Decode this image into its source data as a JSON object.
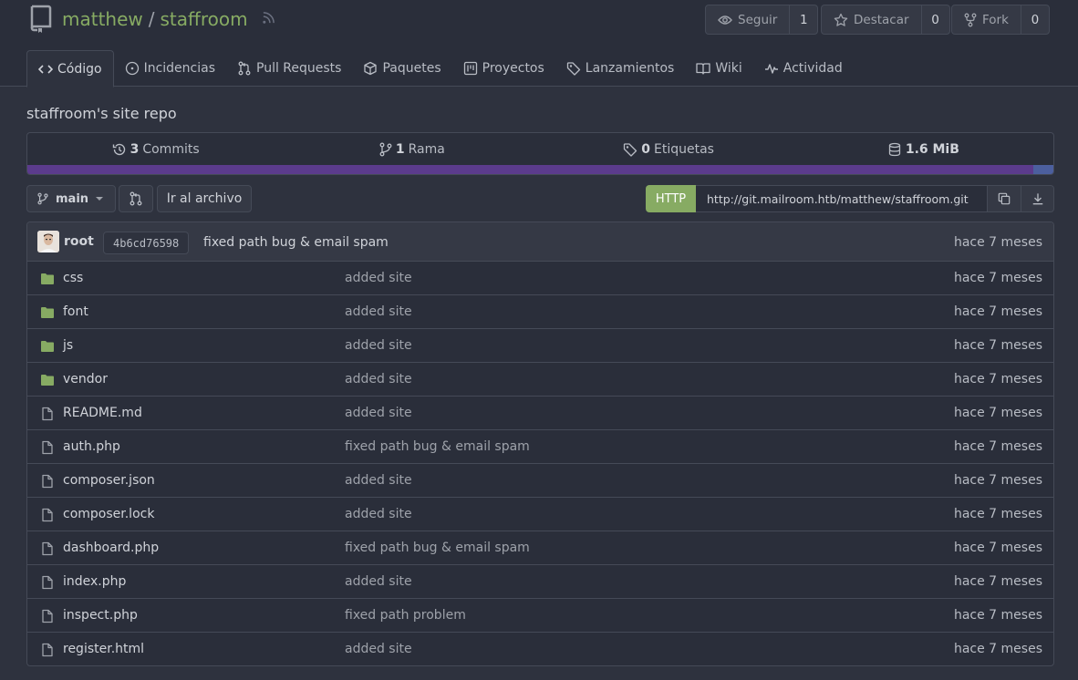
{
  "repo": {
    "owner": "matthew",
    "separator": "/",
    "name": "staffroom",
    "description": "staffroom's site repo"
  },
  "actions": {
    "watch": {
      "label": "Seguir",
      "count": "1"
    },
    "star": {
      "label": "Destacar",
      "count": "0"
    },
    "fork": {
      "label": "Fork",
      "count": "0"
    }
  },
  "tabs": [
    {
      "label": "Código",
      "icon": "code-icon"
    },
    {
      "label": "Incidencias",
      "icon": "issue-icon"
    },
    {
      "label": "Pull Requests",
      "icon": "pull-request-icon"
    },
    {
      "label": "Paquetes",
      "icon": "package-icon"
    },
    {
      "label": "Proyectos",
      "icon": "project-icon"
    },
    {
      "label": "Lanzamientos",
      "icon": "tag-icon"
    },
    {
      "label": "Wiki",
      "icon": "book-icon"
    },
    {
      "label": "Actividad",
      "icon": "pulse-icon"
    }
  ],
  "stats": {
    "commits_count": "3",
    "commits_label": "Commits",
    "branches_count": "1",
    "branches_label": "Rama",
    "tags_count": "0",
    "tags_label": "Etiquetas",
    "size": "1.6 MiB"
  },
  "language_bar": [
    {
      "fraction": 0.98,
      "color": "#5b3b8c"
    },
    {
      "fraction": 0.02,
      "color": "#4c5f9e"
    }
  ],
  "toolbar": {
    "branch": "main",
    "goto_file": "Ir al archivo",
    "clone_protocol": "HTTP",
    "clone_url": "http://git.mailroom.htb/matthew/staffroom.git"
  },
  "latest_commit": {
    "author": "root",
    "sha": "4b6cd76598",
    "message": "fixed path bug & email spam",
    "age": "hace 7 meses"
  },
  "files": [
    {
      "name": "css",
      "type": "folder",
      "message": "added site",
      "age": "hace 7 meses"
    },
    {
      "name": "font",
      "type": "folder",
      "message": "added site",
      "age": "hace 7 meses"
    },
    {
      "name": "js",
      "type": "folder",
      "message": "added site",
      "age": "hace 7 meses"
    },
    {
      "name": "vendor",
      "type": "folder",
      "message": "added site",
      "age": "hace 7 meses"
    },
    {
      "name": "README.md",
      "type": "file",
      "message": "added site",
      "age": "hace 7 meses"
    },
    {
      "name": "auth.php",
      "type": "file",
      "message": "fixed path bug & email spam",
      "age": "hace 7 meses"
    },
    {
      "name": "composer.json",
      "type": "file",
      "message": "added site",
      "age": "hace 7 meses"
    },
    {
      "name": "composer.lock",
      "type": "file",
      "message": "added site",
      "age": "hace 7 meses"
    },
    {
      "name": "dashboard.php",
      "type": "file",
      "message": "fixed path bug & email spam",
      "age": "hace 7 meses"
    },
    {
      "name": "index.php",
      "type": "file",
      "message": "added site",
      "age": "hace 7 meses"
    },
    {
      "name": "inspect.php",
      "type": "file",
      "message": "fixed path problem",
      "age": "hace 7 meses"
    },
    {
      "name": "register.html",
      "type": "file",
      "message": "added site",
      "age": "hace 7 meses"
    }
  ],
  "colors": {
    "accent_green": "#87ab63",
    "folder": "#87ab63",
    "background": "#2e323e"
  }
}
